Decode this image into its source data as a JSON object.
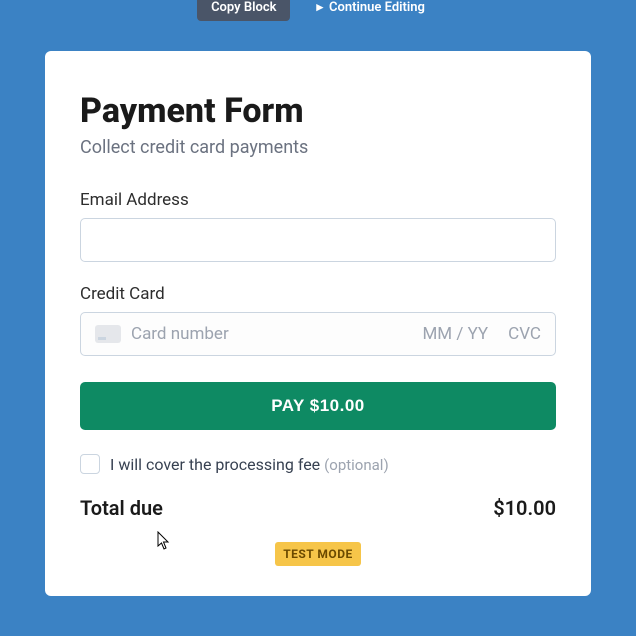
{
  "topbar": {
    "copy_label": "Copy Block",
    "continue_label": "Continue Editing"
  },
  "form": {
    "title": "Payment Form",
    "subtitle": "Collect credit card payments",
    "email": {
      "label": "Email Address",
      "value": ""
    },
    "credit_card": {
      "label": "Credit Card",
      "number_placeholder": "Card number",
      "expiry_placeholder": "MM / YY",
      "cvc_placeholder": "CVC"
    },
    "pay_button": "PAY $10.00",
    "cover_fee": {
      "label": "I will cover the processing fee ",
      "optional": "(optional)"
    },
    "total": {
      "label": "Total due",
      "amount": "$10.00"
    },
    "test_mode": "TEST MODE"
  }
}
